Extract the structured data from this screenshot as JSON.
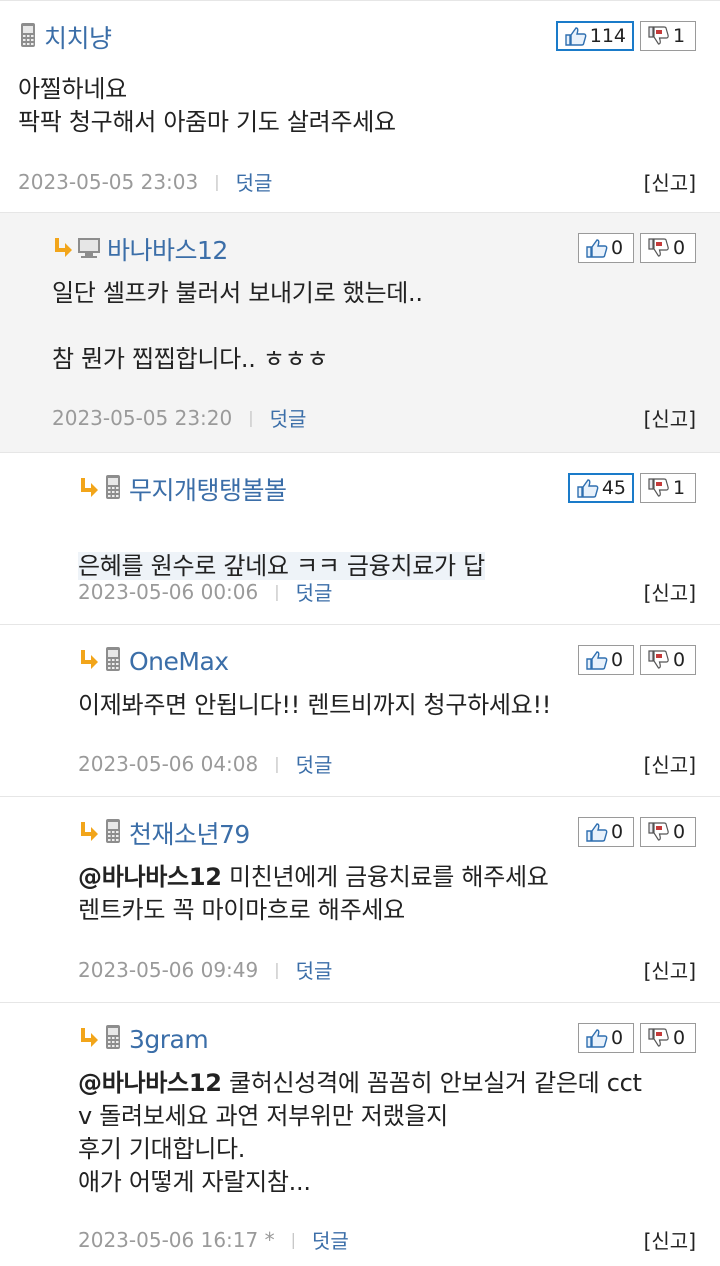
{
  "comments": [
    {
      "author": "치치냥",
      "device": "mobile",
      "is_reply": false,
      "likes": "114",
      "likes_hot": true,
      "dislikes": "1",
      "dislikes_hot": false,
      "body": "아찔하네요\n팍팍 청구해서 아줌마 기도 살려주세요",
      "time": "2023-05-05 23:03",
      "reply_label": "덧글",
      "report_label": "[신고]"
    },
    {
      "author": "바나바스12",
      "device": "desktop",
      "is_reply": true,
      "likes": "0",
      "likes_hot": false,
      "dislikes": "0",
      "dislikes_hot": false,
      "body": "일단 셀프카 불러서 보내기로 했는데..\n\n참 뭔가 찝찝합니다.. ㅎㅎㅎ",
      "time": "2023-05-05 23:20",
      "reply_label": "덧글",
      "report_label": "[신고]"
    },
    {
      "author": "무지개탱탱볼볼",
      "device": "mobile",
      "is_reply": true,
      "likes": "45",
      "likes_hot": true,
      "dislikes": "1",
      "dislikes_hot": false,
      "body": "은혜를 원수로 갚네요 ㅋㅋ 금융치료가 답",
      "time": "2023-05-06 00:06",
      "reply_label": "덧글",
      "report_label": "[신고]"
    },
    {
      "author": "OneMax",
      "device": "mobile",
      "is_reply": true,
      "likes": "0",
      "likes_hot": false,
      "dislikes": "0",
      "dislikes_hot": false,
      "body": "이제봐주면 안됩니다!! 렌트비까지 청구하세요!!",
      "time": "2023-05-06 04:08",
      "reply_label": "덧글",
      "report_label": "[신고]"
    },
    {
      "author": "천재소년79",
      "device": "mobile",
      "is_reply": true,
      "likes": "0",
      "likes_hot": false,
      "dislikes": "0",
      "dislikes_hot": false,
      "mention": "@바나바스12",
      "body": " 미친년에게 금융치료를 해주세요\n렌트카도 꼭 마이마흐로 해주세요",
      "time": "2023-05-06 09:49",
      "reply_label": "덧글",
      "report_label": "[신고]"
    },
    {
      "author": "3gram",
      "device": "mobile",
      "is_reply": true,
      "likes": "0",
      "likes_hot": false,
      "dislikes": "0",
      "dislikes_hot": false,
      "mention": "@바나바스12",
      "body": " 쿨허신성격에 꼼꼼히 안보실거 같은데 cct\nv 돌려보세요 과연 저부위만 저랬을지\n후기 기대합니다.\n애가 어떻게 자랄지참...",
      "time": "2023-05-06 16:17 *",
      "reply_label": "덧글",
      "report_label": "[신고]"
    }
  ],
  "colors": {
    "author": "#3b6ea8",
    "hot_border": "#1a7bc9",
    "reply_bg": "#f4f4f4",
    "arrow": "#f2a51a"
  }
}
